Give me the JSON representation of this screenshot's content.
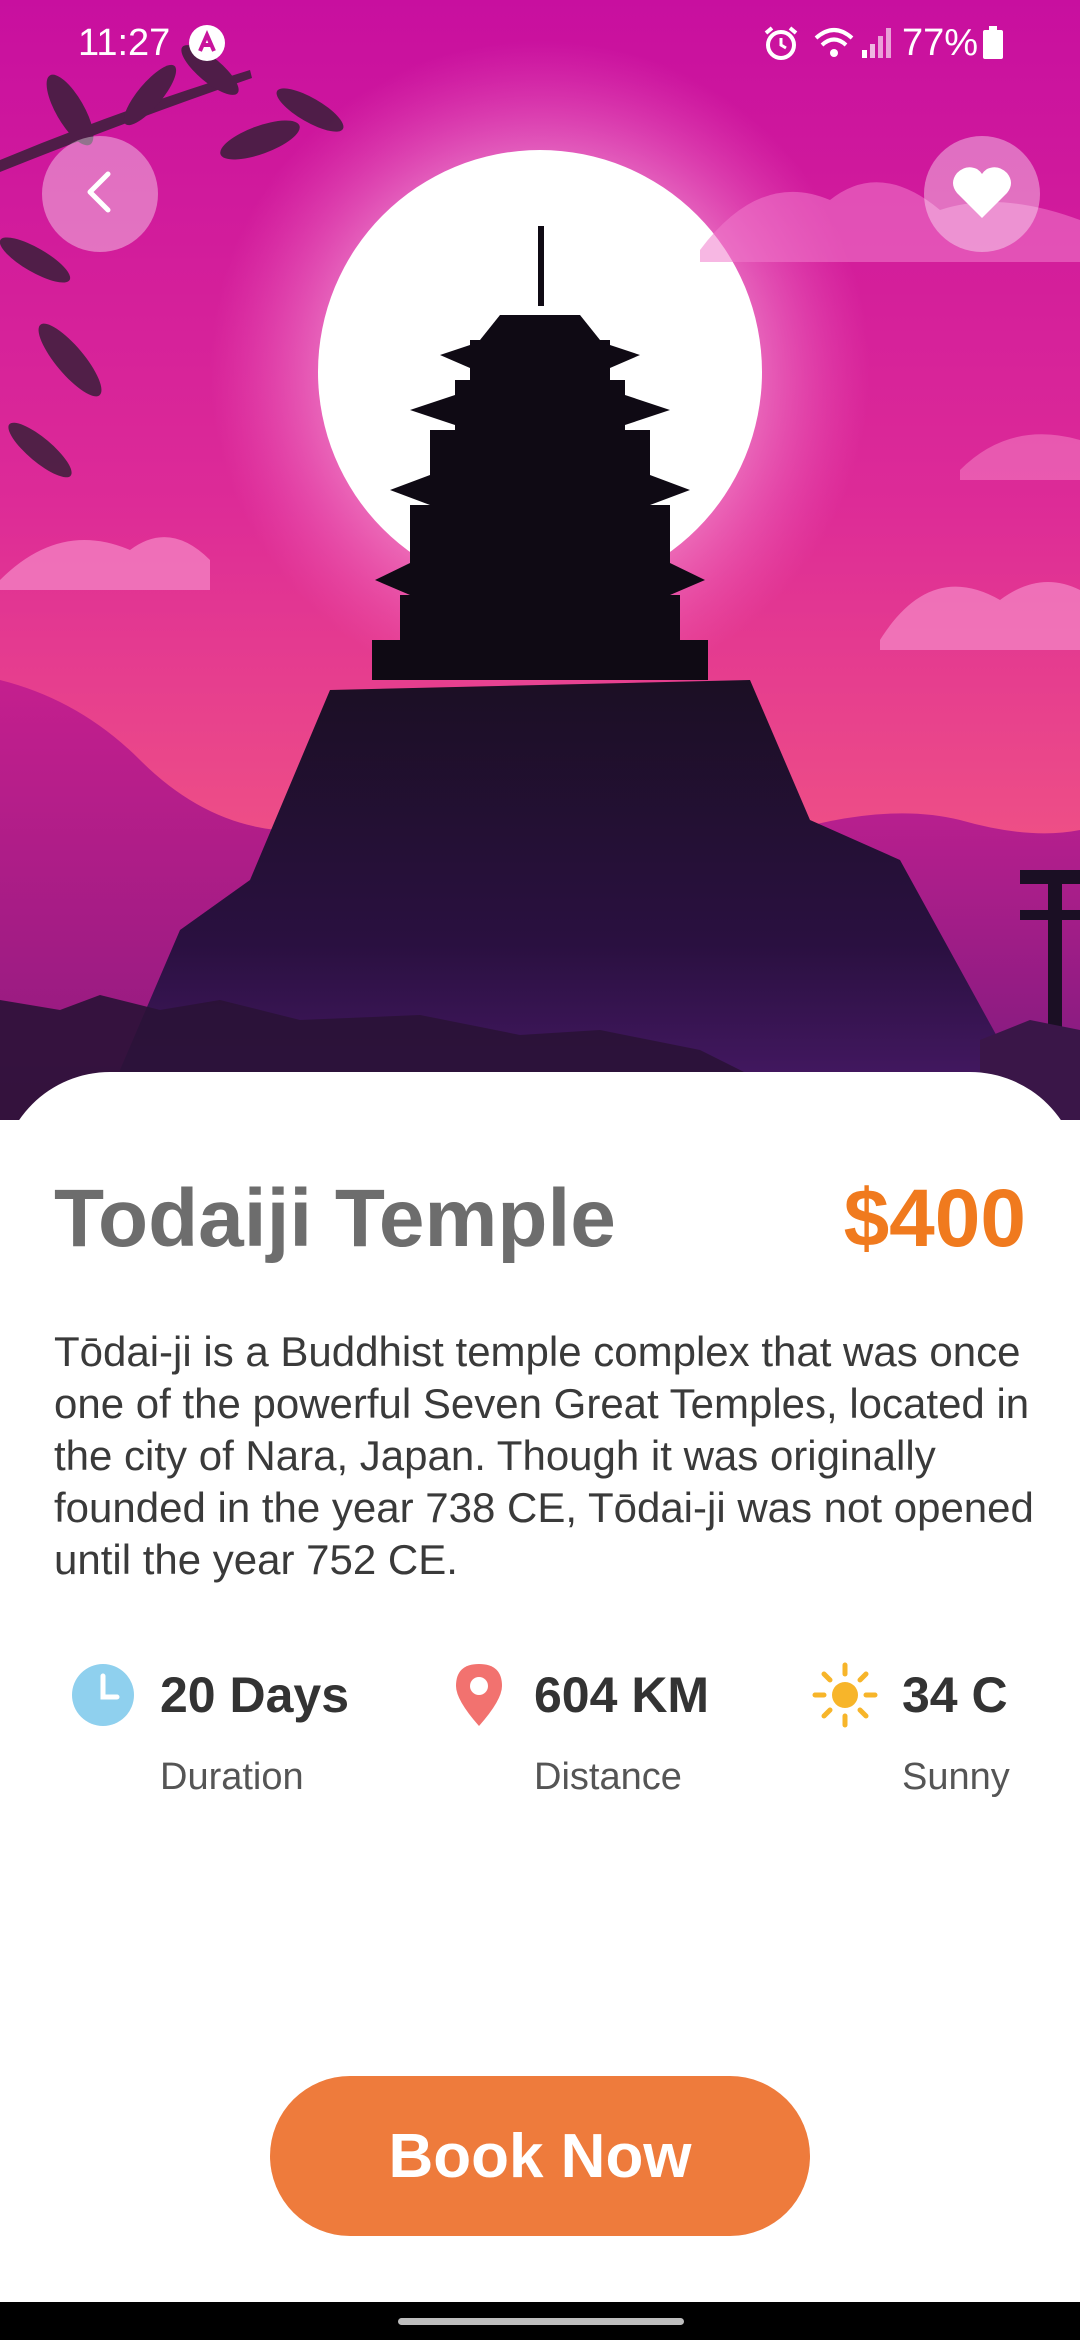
{
  "status_bar": {
    "time": "11:27",
    "battery": "77%",
    "icons": [
      "app-notification-icon",
      "alarm-icon",
      "wifi-icon",
      "signal-icon",
      "battery-icon"
    ]
  },
  "hero": {
    "back_icon": "chevron-left-icon",
    "favorite_icon": "heart-icon"
  },
  "place": {
    "name": "Todaiji Temple",
    "price": "$400",
    "description": "Tōdai-ji is a Buddhist temple complex that was once one of the powerful Seven Great Temples, located in the city of Nara, Japan. Though it was originally founded in the year 738 CE, Tōdai-ji was not opened until the year 752 CE."
  },
  "stats": [
    {
      "value": "20 Days",
      "label": "Duration",
      "icon": "clock-icon",
      "color": "#8fd0ee"
    },
    {
      "value": "604 KM",
      "label": "Distance",
      "icon": "location-pin-icon",
      "color": "#f2726f"
    },
    {
      "value": "34 C",
      "label": "Sunny",
      "icon": "sun-icon",
      "color": "#f7b52a"
    }
  ],
  "actions": {
    "book_label": "Book Now"
  },
  "colors": {
    "accent": "#ee7b3c",
    "price": "#f07a1e",
    "hero_magenta": "#d0209a",
    "hero_dark": "#1c0f2a"
  }
}
